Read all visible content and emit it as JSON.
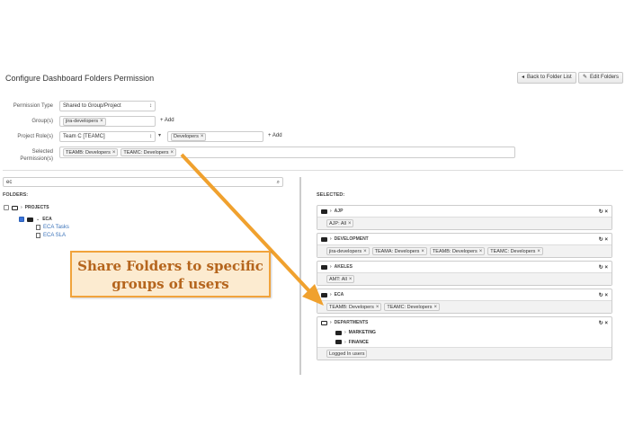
{
  "page": {
    "title": "Configure Dashboard Folders Permission"
  },
  "toolbar": {
    "back_label": "Back to Folder List",
    "edit_label": "Edit Folders"
  },
  "form": {
    "permission_type_label": "Permission Type",
    "permission_type_value": "Shared to Group/Project",
    "groups_label": "Group(s)",
    "groups_tag": "jira-developers",
    "add_label": "Add",
    "project_roles_label": "Project Role(s)",
    "project_value": "Team C [TEAMC]",
    "role_tag": "Developers",
    "selected_label_1": "Selected",
    "selected_label_2": "Permission(s)",
    "selected_tags": [
      "TEAMB: Developers",
      "TEAMC: Developers"
    ]
  },
  "left": {
    "search_value": "ec",
    "folders_heading": "FOLDERS:",
    "projects_label": "PROJECTS",
    "eca_label": "ECA",
    "items": [
      "ECA Tasks",
      "ECA SLA"
    ]
  },
  "right": {
    "selected_heading": "SELECTED:",
    "cards": [
      {
        "name": "AJP",
        "tags": [
          "AJP: All"
        ]
      },
      {
        "name": "DEVELOPMENT",
        "tags": [
          "jira-developers",
          "TEAMA: Developers",
          "TEAMB: Developers",
          "TEAMC: Developers"
        ]
      },
      {
        "name": "AKELES",
        "tags": [
          "AMT: All"
        ]
      },
      {
        "name": "ECA",
        "tags": [
          "TEAMB: Developers",
          "TEAMC: Developers"
        ]
      }
    ],
    "departments": {
      "name": "DEPARTMENTS",
      "children": [
        "MARKETING",
        "FINANCE"
      ],
      "tag": "Logged In users"
    }
  },
  "callout": {
    "line1": "Share Folders to specific",
    "line2": "groups of users"
  },
  "colors": {
    "arrow": "#f0a12e",
    "callout_bg": "#fcebd0",
    "callout_text": "#b5651d",
    "link": "#3b73b9"
  }
}
